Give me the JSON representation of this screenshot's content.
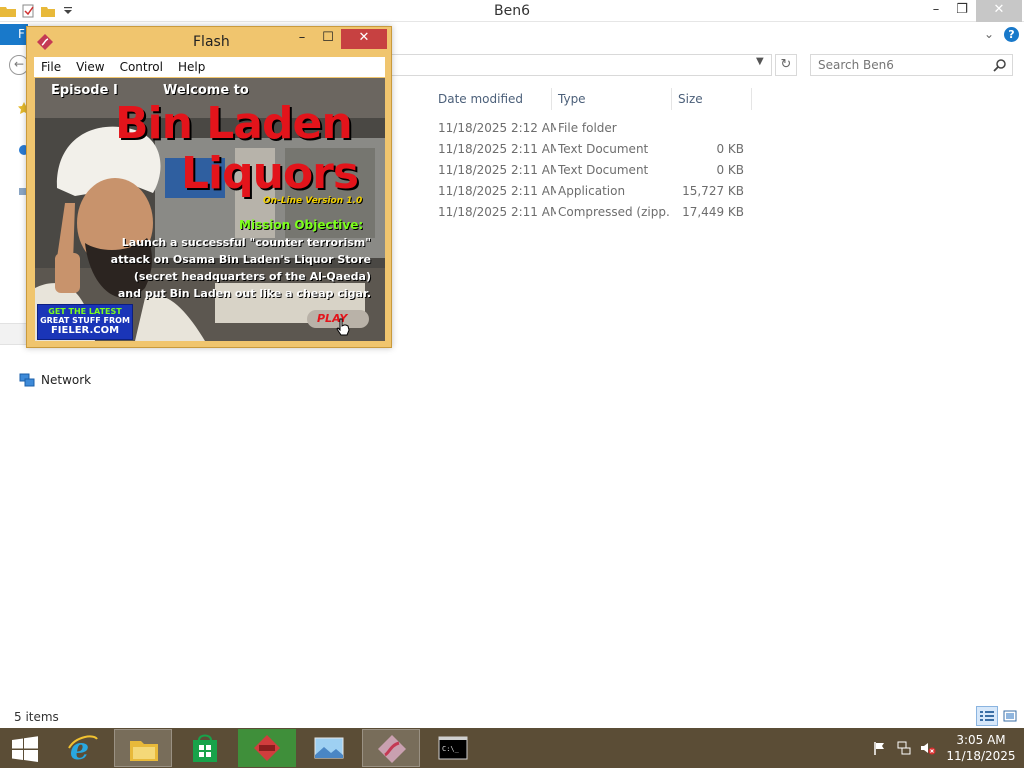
{
  "explorer": {
    "title": "Ben6",
    "file_tab": "F",
    "search_placeholder": "Search Ben6",
    "columns": [
      "Date modified",
      "Type",
      "Size"
    ],
    "rows": [
      {
        "date": "11/18/2025 2:12 AM",
        "type": "File folder",
        "size": ""
      },
      {
        "date": "11/18/2025 2:11 AM",
        "type": "Text Document",
        "size": "0 KB"
      },
      {
        "date": "11/18/2025 2:11 AM",
        "type": "Text Document",
        "size": "0 KB"
      },
      {
        "date": "11/18/2025 2:11 AM",
        "type": "Application",
        "size": "15,727 KB"
      },
      {
        "date": "11/18/2025 2:11 AM",
        "type": "Compressed (zipp...",
        "size": "17,449 KB"
      }
    ],
    "network_label": "Network",
    "status_text": "5 items",
    "accent_color": "#1979ca"
  },
  "flash": {
    "title": "Flash",
    "menu": [
      "File",
      "View",
      "Control",
      "Help"
    ],
    "game": {
      "episode": "Episode I",
      "welcome": "Welcome to",
      "title_line1": "Bin Laden",
      "title_line2": "Liquors",
      "version": "On-Line Version 1.0",
      "mission": "Mission Objective:",
      "description": [
        "Launch a successful \"counter terrorism\"",
        "attack on Osama Bin Laden's Liquor Store",
        "(secret headquarters of the Al-Qaeda)",
        "and put Bin Laden out like a cheap cigar."
      ],
      "promo_line1": "GET THE LATEST",
      "promo_line2": "GREAT STUFF FROM",
      "promo_line3": "FIELER.COM",
      "play_label": "PLAY"
    }
  },
  "taskbar": {
    "items": [
      "start-icon",
      "internet-explorer-icon",
      "file-explorer-icon",
      "store-icon",
      "flash-red-icon",
      "photo-viewer-icon",
      "flash-player-icon",
      "command-prompt-icon"
    ],
    "clock_time": "3:05 AM",
    "clock_date": "11/18/2025",
    "bar_color": "#5b4d36"
  }
}
